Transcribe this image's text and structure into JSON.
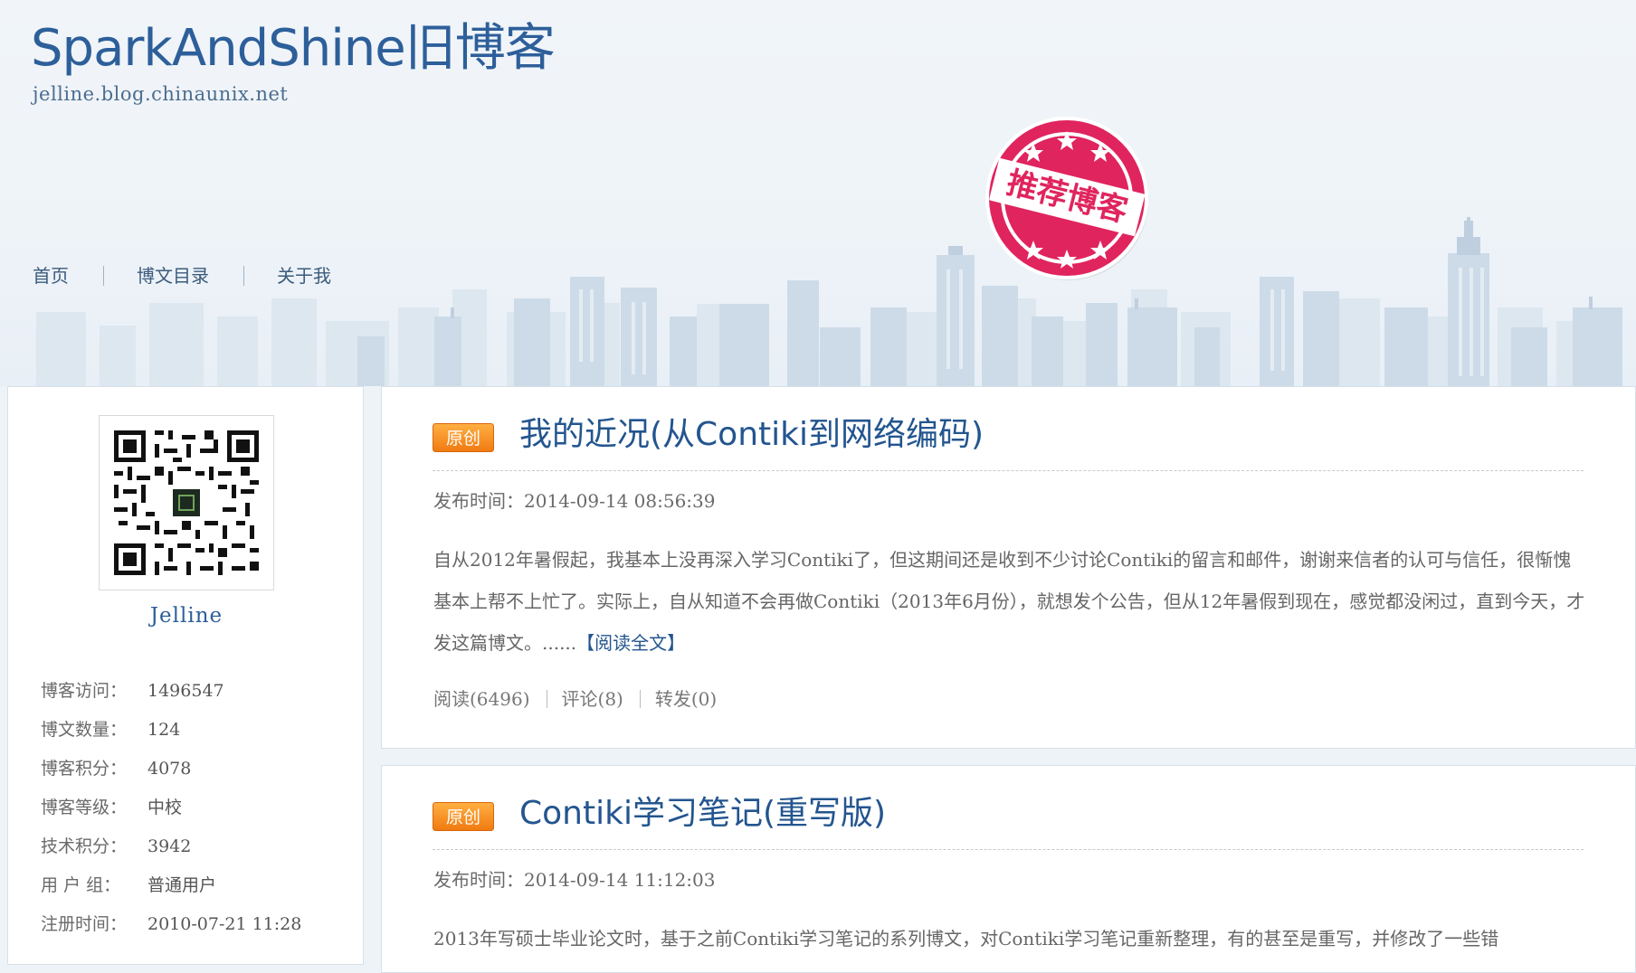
{
  "header": {
    "blog_title": "SparkAndShine旧博客",
    "blog_url": "jelline.blog.chinaunix.net",
    "stamp_text": "推荐博客",
    "nav": [
      "首页",
      "博文目录",
      "关于我"
    ]
  },
  "sidebar": {
    "author_name": "Jelline",
    "stats": [
      {
        "label": "博客访问：",
        "value": "1496547"
      },
      {
        "label": "博文数量：",
        "value": "124"
      },
      {
        "label": "博客积分：",
        "value": "4078"
      },
      {
        "label": "博客等级：",
        "value": "中校"
      },
      {
        "label": "技术积分：",
        "value": "3942"
      },
      {
        "label": "用 户 组：",
        "value": "普通用户"
      },
      {
        "label": "注册时间：",
        "value": "2010-07-21 11:28"
      }
    ]
  },
  "posts": [
    {
      "badge": "原创",
      "title": "我的近况(从Contiki到网络编码)",
      "date": "发布时间：2014-09-14 08:56:39",
      "excerpt": "自从2012年暑假起，我基本上没再深入学习Contiki了，但这期间还是收到不少讨论Contiki的留言和邮件，谢谢来信者的认可与信任，很惭愧基本上帮不上忙了。实际上，自从知道不会再做Contiki（2013年6月份），就想发个公告，但从12年暑假到现在，感觉都没闲过，直到今天，才发这篇博文。......",
      "read_more": "【阅读全文】",
      "reads": "阅读(6496)",
      "comments": "评论(8)",
      "shares": "转发(0)"
    },
    {
      "badge": "原创",
      "title": "Contiki学习笔记(重写版)",
      "date": "发布时间：2014-09-14 11:12:03",
      "excerpt": "2013年写硕士毕业论文时，基于之前Contiki学习笔记的系列博文，对Contiki学习笔记重新整理，有的甚至是重写，并修改了一些错"
    }
  ],
  "colors": {
    "title_blue": "#2d5f9a",
    "link_blue": "#23558f",
    "badge_orange": "#ff8a1e",
    "stamp_red": "#e0245e"
  }
}
